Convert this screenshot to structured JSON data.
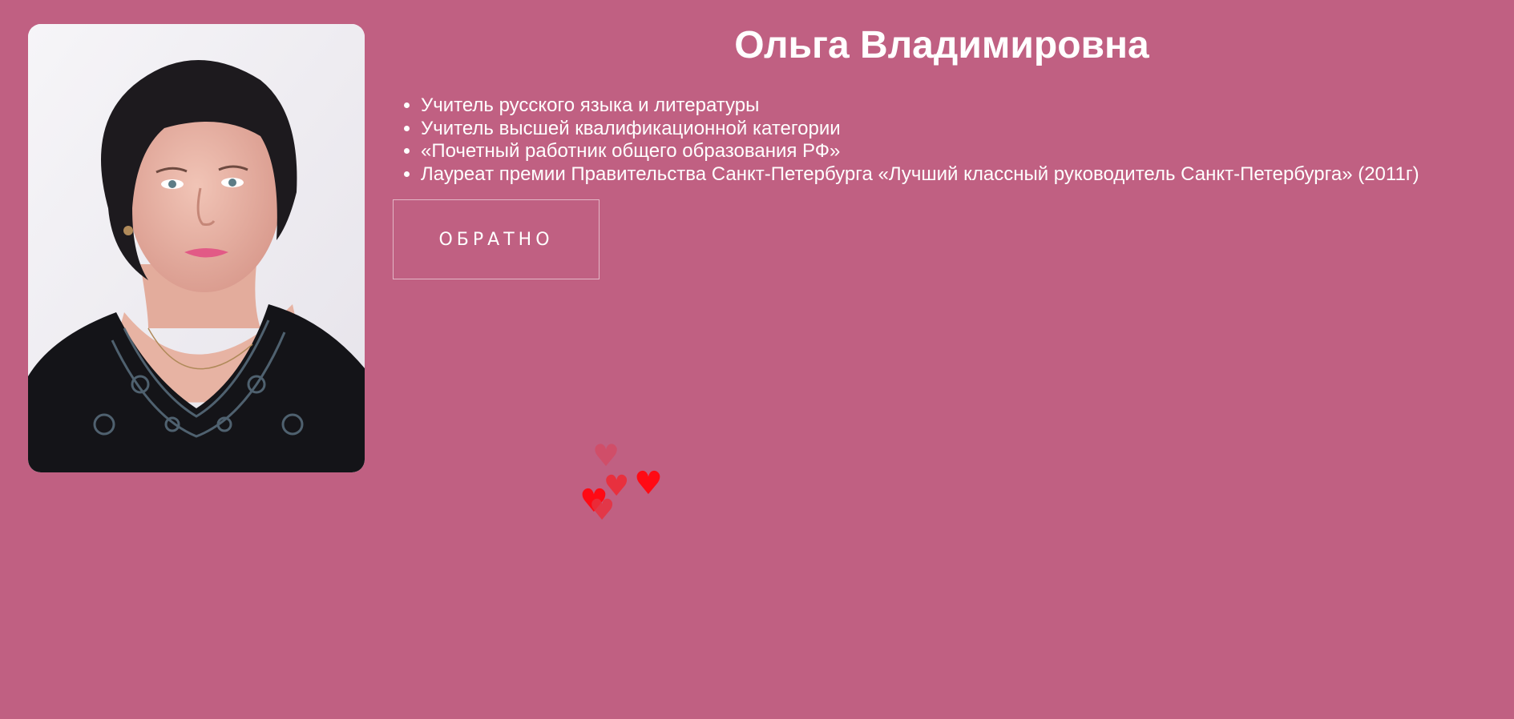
{
  "profile": {
    "name": "Ольга Владимировна",
    "credentials": [
      "Учитель русского языка и литературы",
      "Учитель высшей квалификационной категории",
      "«Почетный работник общего образования РФ»",
      "Лауреат премии Правительства Санкт-Петербурга «Лучший классный руководитель Санкт-Петербурга» (2011г)"
    ],
    "photo_icon": "portrait-photo"
  },
  "actions": {
    "back_label": "ОБРАТНО"
  },
  "decoration": {
    "heart_icon": "heart-icon",
    "heart_glyph": "♥",
    "heart_colors": [
      "#ff0a14",
      "#e8303e",
      "#d44a64"
    ]
  },
  "colors": {
    "background": "#c06082",
    "text": "#ffffff"
  }
}
